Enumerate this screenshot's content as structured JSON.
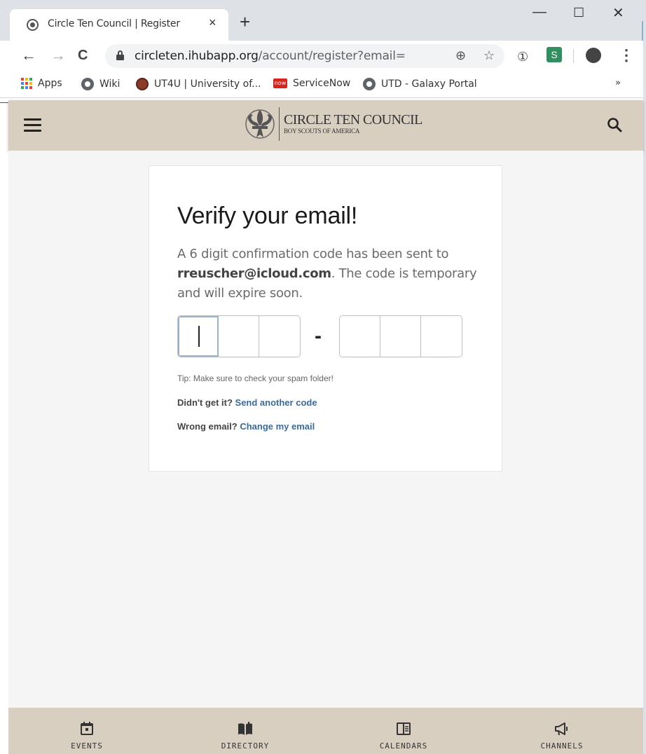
{
  "browser": {
    "tab_title": "Circle Ten Council | Register",
    "tab_close": "×",
    "new_tab": "+",
    "window_controls": {
      "minimize": "—",
      "maximize": "☐",
      "close": "✕"
    },
    "nav": {
      "back": "←",
      "forward": "→",
      "reload": "C"
    },
    "url_host": "circleten.ihubapp.org",
    "url_path": "/account/register?email=",
    "bookmarks": [
      {
        "label": "Apps",
        "icon": "apps-grid-icon"
      },
      {
        "label": "Wiki",
        "icon": "globe-icon"
      },
      {
        "label": "UT4U | University of...",
        "icon": "ut-logo-icon"
      },
      {
        "label": "ServiceNow",
        "icon": "servicenow-icon"
      },
      {
        "label": "UTD - Galaxy Portal",
        "icon": "globe-icon"
      }
    ],
    "servicenow_badge": "now",
    "bookmarks_overflow": "»"
  },
  "site": {
    "logo_line1": "CIRCLE TEN COUNCIL",
    "logo_line2": "BOY SCOUTS OF AMERICA"
  },
  "verify": {
    "heading": "Verify your email!",
    "desc_prefix": "A 6 digit confirmation code has been sent to ",
    "email": "rreuscher@icloud.com",
    "desc_suffix": ". The code is temporary and will expire soon.",
    "code_separator": "-",
    "tip": "Tip: Make sure to check your spam folder!",
    "resend_prompt": "Didn't get it? ",
    "resend_link": "Send another code",
    "change_prompt": "Wrong email? ",
    "change_link": "Change my email"
  },
  "bottom_nav": [
    {
      "label": "EVENTS",
      "icon": "calendar-day-icon"
    },
    {
      "label": "DIRECTORY",
      "icon": "book-open-icon"
    },
    {
      "label": "CALENDARS",
      "icon": "calendar-book-icon"
    },
    {
      "label": "CHANNELS",
      "icon": "megaphone-icon"
    }
  ],
  "colors": {
    "header_bg": "#d9cfc0",
    "link": "#3b6a9f",
    "page_bg": "#f5f5f5"
  }
}
